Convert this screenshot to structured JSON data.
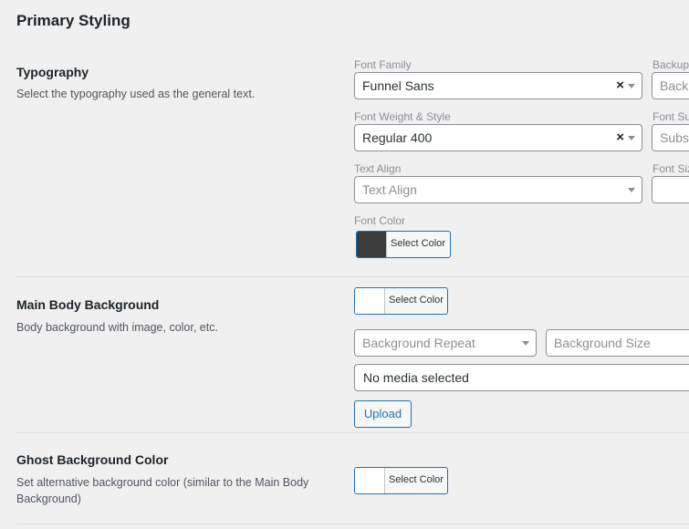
{
  "page": {
    "title": "Primary Styling"
  },
  "typography": {
    "title": "Typography",
    "description": "Select the typography used as the general text.",
    "font_family": {
      "label": "Font Family",
      "value": "Funnel Sans"
    },
    "backup": {
      "label": "Backup",
      "placeholder": "Backu"
    },
    "font_weight": {
      "label": "Font Weight & Style",
      "value": "Regular 400"
    },
    "font_subset": {
      "label": "Font Su",
      "placeholder": "Subse"
    },
    "text_align": {
      "label": "Text Align",
      "placeholder": "Text Align"
    },
    "font_size": {
      "label": "Font Siz"
    },
    "font_color": {
      "label": "Font Color",
      "button_label": "Select Color",
      "swatch": "#3c3c3c"
    }
  },
  "main_body_background": {
    "title": "Main Body Background",
    "description": "Body background with image, color, etc.",
    "color": {
      "button_label": "Select Color",
      "swatch": "#ffffff"
    },
    "repeat": {
      "placeholder": "Background Repeat"
    },
    "size": {
      "placeholder": "Background Size"
    },
    "media": {
      "value": "No media selected"
    },
    "upload_label": "Upload"
  },
  "ghost_background": {
    "title": "Ghost Background Color",
    "description": "Set alternative background color (similar to the Main Body Background)",
    "color": {
      "button_label": "Select Color",
      "swatch": "#ffffff"
    }
  },
  "icons": {
    "clear": "clear-x-icon",
    "caret": "caret-down-icon"
  },
  "colors": {
    "accent": "#2271b1",
    "page_bg": "#f0f0f1"
  }
}
